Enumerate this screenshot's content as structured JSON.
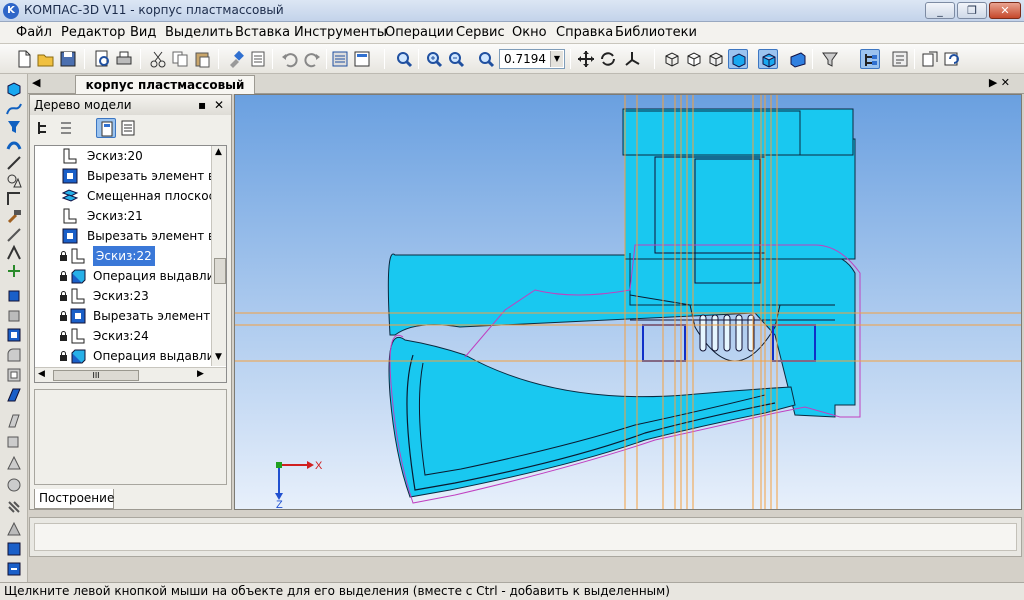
{
  "window": {
    "title": "КОМПАС-3D V11 - корпус пластмассовый",
    "logo_letter": "K",
    "minimize": "_",
    "maximize": "❐",
    "close": "✕"
  },
  "menu": [
    "Файл",
    "Редактор",
    "Вид",
    "Выделить",
    "Вставка",
    "Инструменты",
    "Операции",
    "Сервис",
    "Окно",
    "Справка",
    "Библиотеки"
  ],
  "toolbar": {
    "zoom_value": "0.7194",
    "icons": [
      "new-file",
      "open-file",
      "save-file",
      "print-preview",
      "cut",
      "copy",
      "paste",
      "format-brush",
      "undo",
      "redo",
      "properties",
      "manager",
      "zoom-window",
      "zoom-in",
      "zoom-out",
      "zoom-fit",
      "pan",
      "rotate",
      "orientation",
      "view-wireframe",
      "view-hidden-lines",
      "view-hidden-removed",
      "view-halftone",
      "view-halftone-edges",
      "perspective",
      "filters",
      "model-tree-toggle",
      "update-model",
      "rebuild",
      "hatch"
    ]
  },
  "document_tab": {
    "label": "корпус пластмассовый",
    "left_arrow": "◀",
    "right_arrows": "▶ ✕"
  },
  "model_tree": {
    "title": "Дерево модели",
    "pin": "▪",
    "close": "✕",
    "items": [
      {
        "label": "Эскиз:20",
        "kind": "sketch",
        "locked": false,
        "selected": false
      },
      {
        "label": "Вырезать элемент вы",
        "kind": "cut",
        "locked": false,
        "selected": false
      },
      {
        "label": "Смещенная плоскост",
        "kind": "plane",
        "locked": false,
        "selected": false
      },
      {
        "label": "Эскиз:21",
        "kind": "sketch",
        "locked": false,
        "selected": false
      },
      {
        "label": "Вырезать элемент вы",
        "kind": "cut",
        "locked": false,
        "selected": false
      },
      {
        "label": "Эскиз:22",
        "kind": "sketch",
        "locked": true,
        "selected": true
      },
      {
        "label": "Операция выдавливан",
        "kind": "extrude",
        "locked": true,
        "selected": false
      },
      {
        "label": "Эскиз:23",
        "kind": "sketch",
        "locked": true,
        "selected": false
      },
      {
        "label": "Вырезать элемент в",
        "kind": "cut",
        "locked": true,
        "selected": false
      },
      {
        "label": "Эскиз:24",
        "kind": "sketch",
        "locked": true,
        "selected": false
      },
      {
        "label": "Операция выдавлив",
        "kind": "extrude",
        "locked": true,
        "selected": false
      }
    ],
    "build_tab": "Построение",
    "scroll_grip": "III"
  },
  "viewport": {
    "axis_x": "X",
    "axis_z": "Z",
    "bg_top": "#6aa0e0",
    "bg_bottom": "#e8f0fb",
    "part_color": "#19c8f0",
    "guide_color": "#f4a040",
    "sketch_color": "#c040c0"
  },
  "status": {
    "hint": "Щелкните левой кнопкой мыши на объекте для его выделения (вместе с Ctrl - добавить к выделенным)"
  }
}
